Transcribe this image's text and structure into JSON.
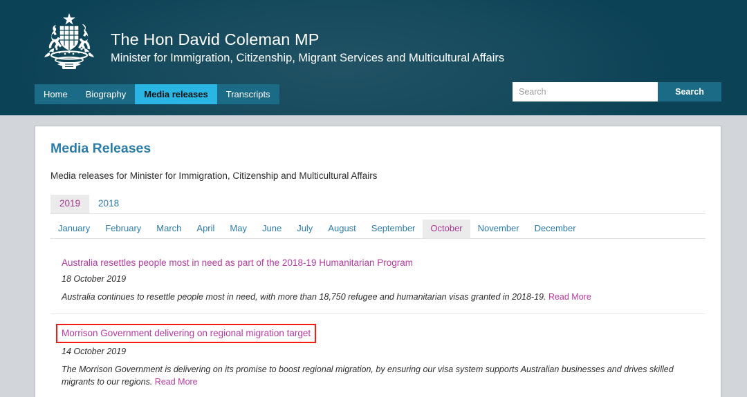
{
  "header": {
    "crest_icon": "australian-coat-of-arms",
    "title": "The Hon David Coleman MP",
    "subtitle": "Minister for Immigration, Citizenship, Migrant Services and Multicultural Affairs",
    "brand_bg": "#0c4256"
  },
  "nav": {
    "items": [
      {
        "label": "Home",
        "active": false
      },
      {
        "label": "Biography",
        "active": false
      },
      {
        "label": "Media releases",
        "active": true
      },
      {
        "label": "Transcripts",
        "active": false
      }
    ],
    "active_bg": "#2ab6e4",
    "bar_bg": "#1b6a86"
  },
  "search": {
    "placeholder": "Search",
    "value": "",
    "button_label": "Search"
  },
  "main": {
    "title": "Media Releases",
    "intro": "Media releases for Minister for Immigration, Citizenship and Multicultural Affairs",
    "year_tabs": [
      {
        "label": "2019",
        "active": true
      },
      {
        "label": "2018",
        "active": false
      }
    ],
    "month_tabs": [
      {
        "label": "January",
        "active": false
      },
      {
        "label": "February",
        "active": false
      },
      {
        "label": "March",
        "active": false
      },
      {
        "label": "April",
        "active": false
      },
      {
        "label": "May",
        "active": false
      },
      {
        "label": "June",
        "active": false
      },
      {
        "label": "July",
        "active": false
      },
      {
        "label": "August",
        "active": false
      },
      {
        "label": "September",
        "active": false
      },
      {
        "label": "October",
        "active": true
      },
      {
        "label": "November",
        "active": false
      },
      {
        "label": "December",
        "active": false
      }
    ],
    "articles": [
      {
        "title": "Australia resettles people most in need as part of the 2018-19 Humanitarian Program",
        "date": "18 October 2019",
        "description": "Australia continues to resettle people most in need, with more than 18,750 refugee and humanitarian visas granted in 2018-19.",
        "read_more": "Read More",
        "highlighted": false
      },
      {
        "title": "Morrison Government delivering on regional migration target",
        "date": "14 October 2019",
        "description": "The Morrison Government is delivering on its promise to boost regional migration, by ensuring our visa system supports Australian businesses and drives skilled migrants to our regions.",
        "read_more": "Read More",
        "highlighted": true
      }
    ],
    "link_color": "#b5399f",
    "tab_link_color": "#2a7ca8",
    "active_tab_color": "#a8338f",
    "highlight_color": "#f61b11"
  }
}
